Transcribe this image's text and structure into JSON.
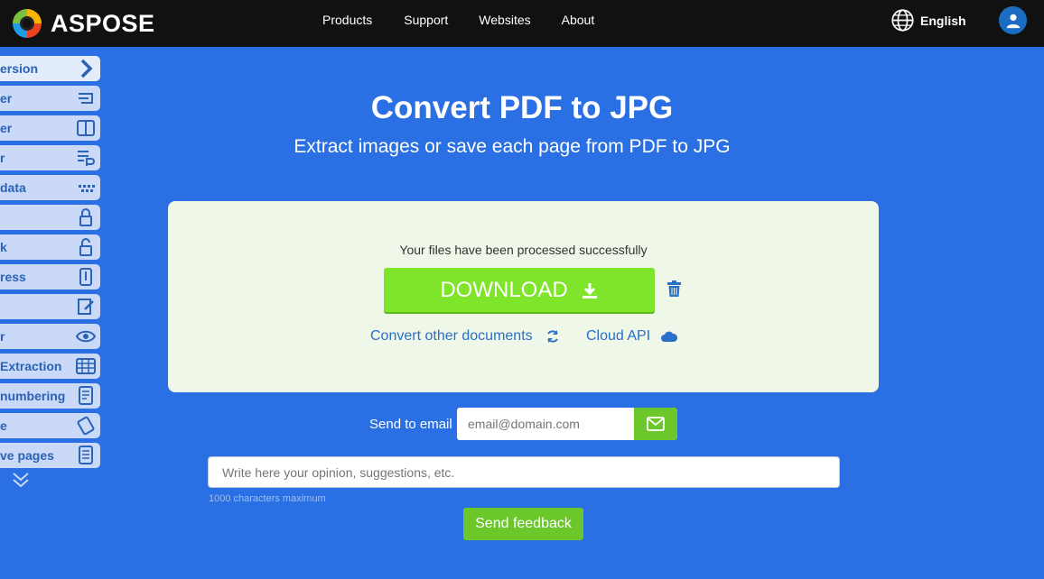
{
  "header": {
    "brand": "ASPOSE",
    "nav": [
      "Products",
      "Support",
      "Websites",
      "About"
    ],
    "language": "English"
  },
  "sidebar": {
    "items": [
      {
        "label": "ersion",
        "icon": "chevron-right-icon"
      },
      {
        "label": "er",
        "icon": "merge-icon"
      },
      {
        "label": "er",
        "icon": "split-icon"
      },
      {
        "label": "r",
        "icon": "parser-icon"
      },
      {
        "label": "data",
        "icon": "metadata-icon"
      },
      {
        "label": "",
        "icon": "lock-icon"
      },
      {
        "label": "k",
        "icon": "unlock-icon"
      },
      {
        "label": "ress",
        "icon": "compress-icon"
      },
      {
        "label": "",
        "icon": "edit-icon"
      },
      {
        "label": "r",
        "icon": "eye-icon"
      },
      {
        "label": "Extraction",
        "icon": "table-icon"
      },
      {
        "label": "numbering",
        "icon": "numbering-icon"
      },
      {
        "label": "e",
        "icon": "signature-icon"
      },
      {
        "label": "ve pages",
        "icon": "remove-pages-icon"
      }
    ],
    "more_icon": "double-chevron-down-icon"
  },
  "hero": {
    "title": "Convert PDF to JPG",
    "subtitle": "Extract images or save each page from PDF to JPG"
  },
  "result": {
    "status": "Your files have been processed successfully",
    "download_label": "DOWNLOAD",
    "convert_other_label": "Convert other documents",
    "cloud_api_label": "Cloud API"
  },
  "email": {
    "label": "Send to email",
    "placeholder": "email@domain.com"
  },
  "feedback": {
    "placeholder": "Write here your opinion, suggestions, etc.",
    "max_chars": "1000 characters maximum",
    "send_label": "Send feedback"
  },
  "colors": {
    "background": "#2a6fe3",
    "header": "#111111",
    "download": "#7ee52a",
    "button_green": "#6bc72a",
    "card": "#eff7e8",
    "link": "#2a6fc8"
  }
}
